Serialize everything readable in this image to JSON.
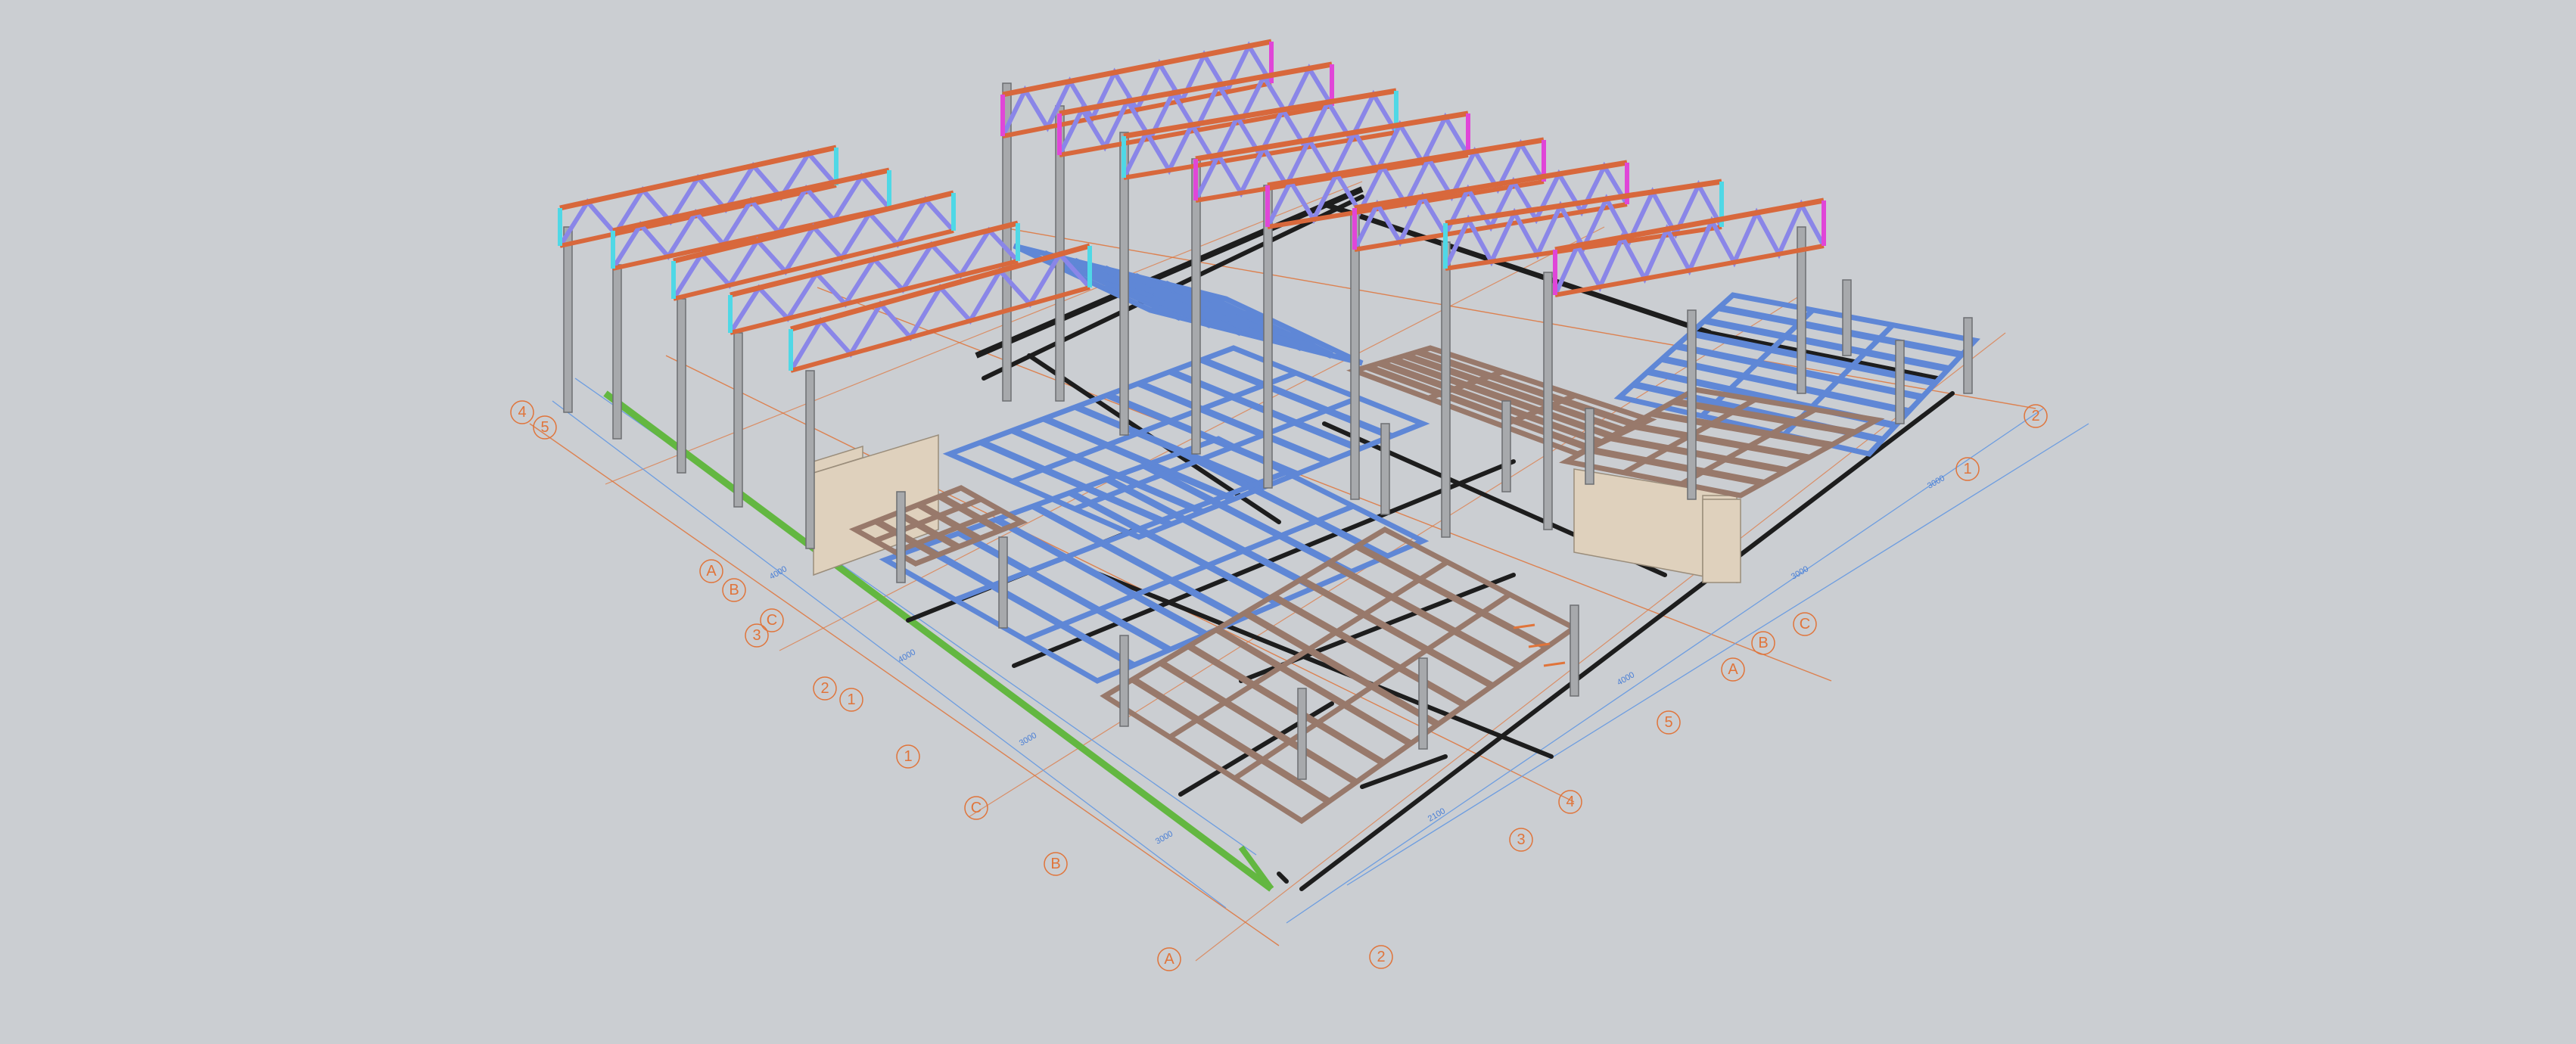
{
  "viewport": {
    "background": "#cbced2",
    "colors": {
      "truss_chord": "#d8683c",
      "truss_web": "#8a86e8",
      "truss_end": "#e046d8",
      "truss_end_alt": "#4fd8e6",
      "column": "#a7a9ac",
      "column_edge": "#6d6f72",
      "joist_blue": "#5f87d6",
      "joist_brown": "#98796b",
      "grid_line": "#e0743a",
      "dimension_line": "#6d9de0",
      "beam_dark": "#1d1d1d",
      "beam_green": "#63b741",
      "wall_panel": "#dfd1bd"
    },
    "grid_bubbles": [
      "A",
      "B",
      "C",
      "1",
      "2",
      "3",
      "4",
      "5"
    ],
    "dimension_texts": [
      "4000",
      "4000",
      "3000",
      "3000",
      "2100",
      "4000",
      "3000",
      "3000"
    ]
  }
}
